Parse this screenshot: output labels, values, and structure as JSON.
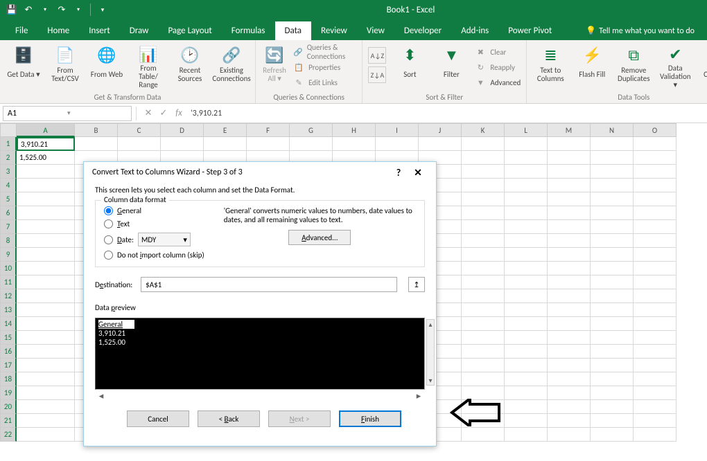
{
  "app": {
    "title": "Book1 - Excel"
  },
  "qat": {
    "save_icon": "💾",
    "undo_label": "↶",
    "redo_label": "↷"
  },
  "tabs": [
    "File",
    "Home",
    "Insert",
    "Draw",
    "Page Layout",
    "Formulas",
    "Data",
    "Review",
    "View",
    "Developer",
    "Add-ins",
    "Power Pivot"
  ],
  "active_tab_index": 6,
  "tell_me": "Tell me what you want to do",
  "ribbon": {
    "groups": [
      {
        "name": "Get & Transform Data",
        "buttons": [
          "Get Data ▾",
          "From Text/CSV",
          "From Web",
          "From Table/ Range",
          "Recent Sources",
          "Existing Connections"
        ]
      },
      {
        "name": "Queries & Connections",
        "buttons": [
          "Refresh All ▾"
        ],
        "side": [
          "Queries & Connections",
          "Properties",
          "Edit Links"
        ]
      },
      {
        "name": "Sort & Filter",
        "buttons": [
          "A→Z Z→A",
          "Sort",
          "Filter"
        ],
        "side": [
          "Clear",
          "Reapply",
          "Advanced"
        ]
      },
      {
        "name": "Data Tools",
        "buttons": [
          "Text to Columns",
          "Flash Fill",
          "Remove Duplicates",
          "Data Validation ▾",
          "Consolid"
        ]
      }
    ]
  },
  "formulabar": {
    "namebox": "A1",
    "value": "'3,910.21"
  },
  "columns": [
    "A",
    "B",
    "C",
    "D",
    "E",
    "F",
    "G",
    "H",
    "I",
    "J",
    "K",
    "L",
    "M",
    "N",
    "O"
  ],
  "row_count": 22,
  "cells": {
    "A1": "3,910.21",
    "A2": "1,525.00"
  },
  "selected_col": "A",
  "dialog": {
    "title": "Convert Text to Columns Wizard - Step 3 of 3",
    "description": "This screen lets you select each column and set the Data Format.",
    "fieldset_label": "Column data format",
    "radios": {
      "general": "General",
      "text": "Text",
      "date": "Date:",
      "skip": "Do not import column (skip)"
    },
    "selected_radio": "general",
    "date_format": "MDY",
    "format_description": "'General' converts numeric values to numbers, date values to dates, and all remaining values to text.",
    "advanced_btn": "Advanced...",
    "destination_label": "Destination:",
    "destination_value": "$A$1",
    "preview_label": "Data preview",
    "preview_header": "General",
    "preview_rows": [
      "3,910.21",
      "1,525.00"
    ],
    "buttons": {
      "cancel": "Cancel",
      "back": "< Back",
      "next": "Next >",
      "finish": "Finish"
    }
  }
}
